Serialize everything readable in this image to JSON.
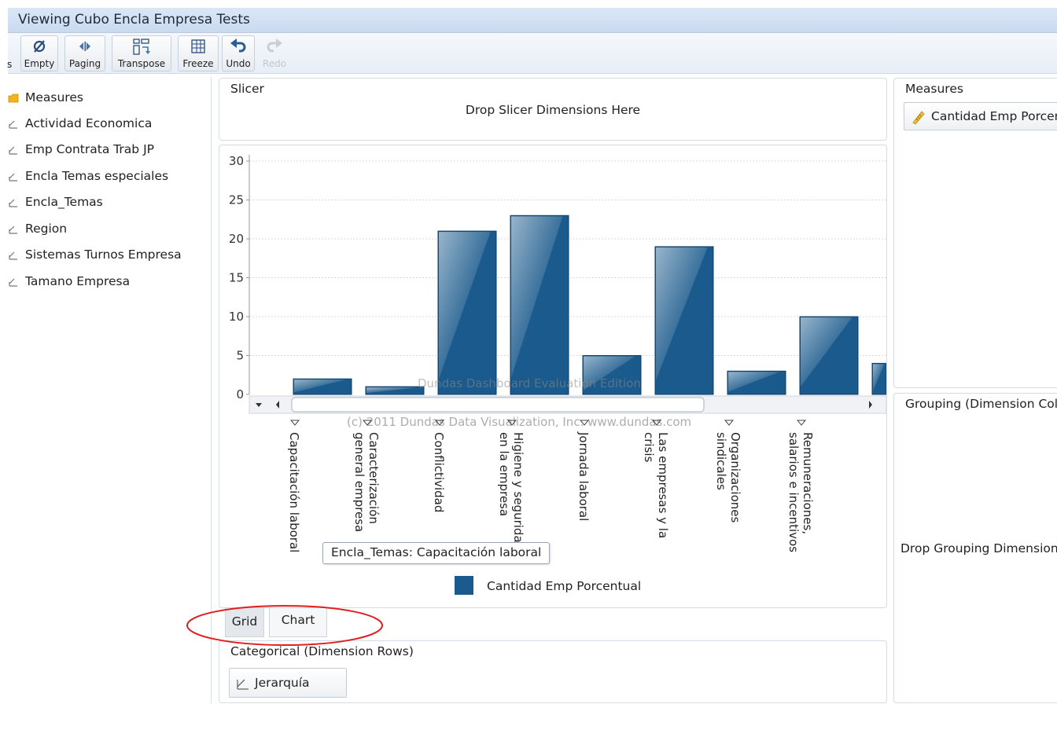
{
  "window": {
    "title": "Viewing Cubo Encla Empresa Tests"
  },
  "toolbar": {
    "partial_label": "s",
    "buttons": [
      {
        "label": "Empty",
        "icon": "empty-set-icon"
      },
      {
        "label": "Paging",
        "icon": "paging-icon"
      },
      {
        "label": "Transpose",
        "icon": "transpose-icon"
      },
      {
        "label": "Freeze",
        "icon": "freeze-grid-icon"
      },
      {
        "label": "Undo",
        "icon": "undo-icon"
      },
      {
        "label": "Redo",
        "icon": "redo-icon",
        "disabled": true
      }
    ]
  },
  "dimension_list": {
    "items": [
      {
        "label": "Measures",
        "icon": "folder-icon"
      },
      {
        "label": "Actividad Economica",
        "icon": "hierarchy-icon"
      },
      {
        "label": "Emp Contrata Trab JP",
        "icon": "hierarchy-icon"
      },
      {
        "label": "Encla Temas especiales",
        "icon": "hierarchy-icon"
      },
      {
        "label": "Encla_Temas",
        "icon": "hierarchy-icon"
      },
      {
        "label": "Region",
        "icon": "hierarchy-icon"
      },
      {
        "label": "Sistemas Turnos Empresa",
        "icon": "hierarchy-icon"
      },
      {
        "label": "Tamano Empresa",
        "icon": "hierarchy-icon"
      }
    ]
  },
  "slicer": {
    "title": "Slicer",
    "drop_hint": "Drop Slicer Dimensions Here"
  },
  "measures_panel": {
    "title": "Measures",
    "chip_label": "Cantidad Emp Porcentual"
  },
  "grouping_panel": {
    "title": "Grouping (Dimension Columns)",
    "drop_hint": "Drop Grouping Dimensions Here"
  },
  "categorical_panel": {
    "title": "Categorical (Dimension Rows)",
    "chip_label": "Jerarquía"
  },
  "view_tabs": {
    "grid": "Grid",
    "chart": "Chart",
    "active": "Chart"
  },
  "chart": {
    "watermark_1": "Dundas Dashboard Evaluation Edition",
    "watermark_2": "(c) 2011 Dundas Data Visualization, Inc. www.dundas.com",
    "tooltip": "Encla_Temas: Capacitación laboral",
    "category_lines": [
      [
        "Capacitación laboral"
      ],
      [
        "Caracterización",
        "general empresa"
      ],
      [
        "Conflictividad"
      ],
      [
        "Higiene y seguridad",
        "en la empresa"
      ],
      [
        "Jornada laboral"
      ],
      [
        "Las empresas y la",
        "crisis"
      ],
      [
        "Organizaciones",
        "sindicales"
      ],
      [
        "Remuneraciones,",
        "salarios e incentivos"
      ]
    ],
    "bar_color": "#1a5a8c",
    "annotation_color": "#e02020"
  },
  "chart_data": {
    "type": "bar",
    "categories": [
      "Capacitación laboral",
      "Caracterización general empresa",
      "Conflictividad",
      "Higiene y seguridad en la empresa",
      "Jornada laboral",
      "Las empresas y la crisis",
      "Organizaciones sindicales",
      "Remuneraciones, salarios e incentivos",
      ""
    ],
    "series": [
      {
        "name": "Cantidad Emp Porcentual",
        "values": [
          2,
          1,
          21,
          23,
          5,
          19,
          3,
          10,
          4
        ]
      }
    ],
    "ylim": [
      0,
      30
    ],
    "yticks": [
      0,
      5,
      10,
      15,
      20,
      25,
      30
    ],
    "grid": true,
    "legend": "bottom",
    "legend_label": "Cantidad Emp Porcentual"
  }
}
